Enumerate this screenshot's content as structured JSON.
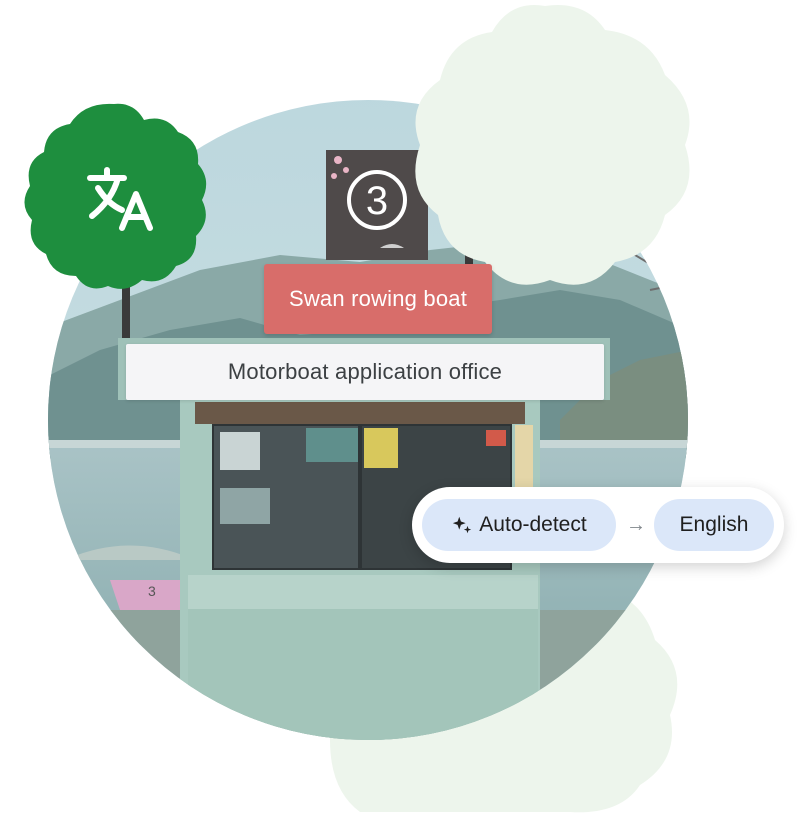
{
  "signs": {
    "upper_translation": "Swan rowing boat",
    "lower_translation": "Motorboat application office",
    "booth_number": "3"
  },
  "language_bar": {
    "source_label": "Auto-detect",
    "arrow": "→",
    "target_label": "English"
  },
  "icons": {
    "badge_icon": "translate-icon",
    "sparkle_icon": "sparkle-icon"
  },
  "colors": {
    "badge_green": "#1e8e3e",
    "red_overlay": "#d86d6a",
    "chip_blue": "#dbe7f9",
    "decor_mint": "#edf5ec"
  }
}
